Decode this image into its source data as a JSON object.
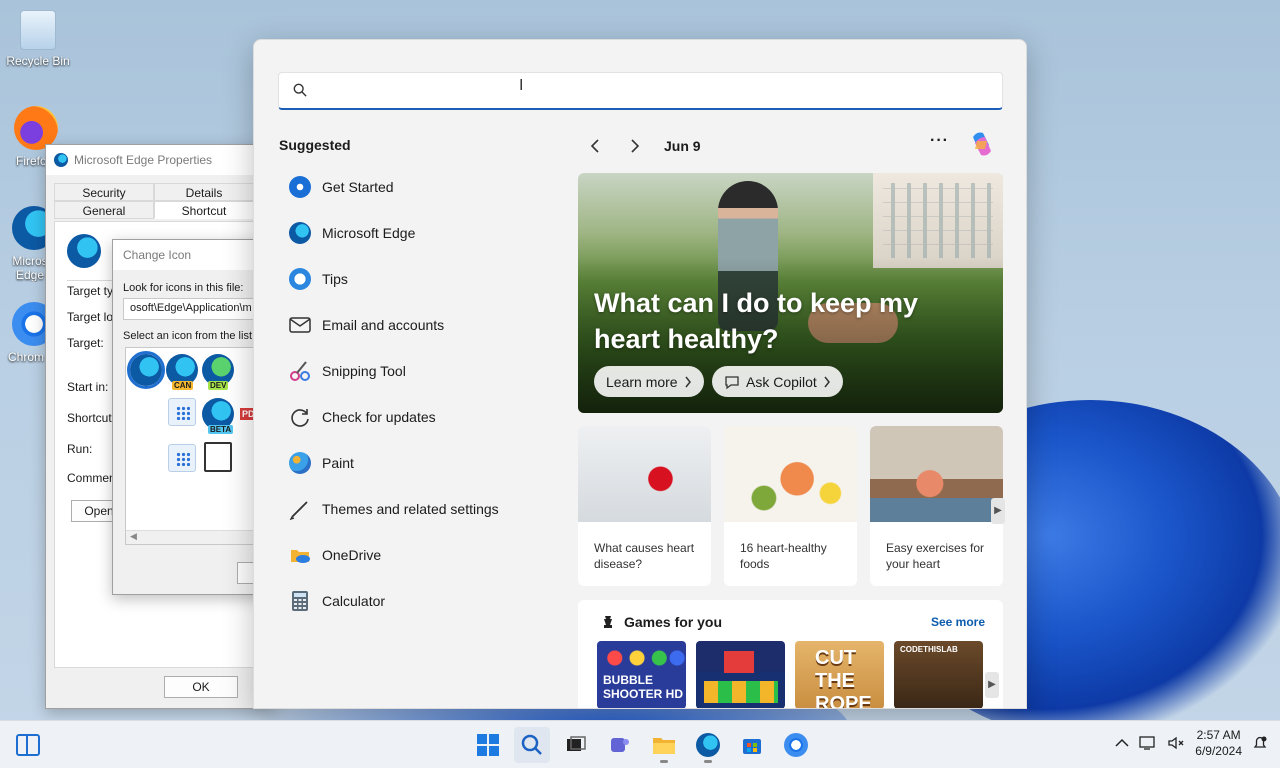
{
  "desktop": {
    "icons": [
      {
        "label": "Recycle Bin",
        "icon": "recycle-bin-icon"
      },
      {
        "label": "Firefo",
        "icon": "firefox-icon"
      },
      {
        "label": "Micros Edge",
        "icon": "edge-icon"
      },
      {
        "label": "Chrom",
        "icon": "chrome-icon"
      }
    ]
  },
  "properties_dialog": {
    "title": "Microsoft Edge Properties",
    "tabs_row1": [
      "Security",
      "Details"
    ],
    "tabs_row2": [
      "General",
      "Shortcut"
    ],
    "fields": [
      "Target typ",
      "Target loc",
      "Target:",
      "Start in:",
      "Shortcut k",
      "Run:",
      "Comment:"
    ],
    "open_button": "Open",
    "ok_button": "OK"
  },
  "change_icon_dialog": {
    "title": "Change Icon",
    "look_label": "Look for icons in this file:",
    "path_value": "osoft\\Edge\\Application\\m",
    "select_label": "Select an icon from the list",
    "badges": {
      "can": "CAN",
      "dev": "DEV",
      "beta": "BETA",
      "pdf": "PD"
    }
  },
  "start_menu": {
    "search_placeholder": "",
    "suggested_title": "Suggested",
    "suggested": [
      {
        "label": "Get Started",
        "icon": "get-started-icon",
        "color": "#1a6fd6"
      },
      {
        "label": "Microsoft Edge",
        "icon": "edge-icon",
        "color": "#0c59a4"
      },
      {
        "label": "Tips",
        "icon": "tips-icon",
        "color": "#2b86e0"
      },
      {
        "label": "Email and accounts",
        "icon": "mail-icon",
        "color": "#333333"
      },
      {
        "label": "Snipping Tool",
        "icon": "snipping-tool-icon",
        "color": "#d13b8a"
      },
      {
        "label": "Check for updates",
        "icon": "update-icon",
        "color": "#333333"
      },
      {
        "label": "Paint",
        "icon": "paint-icon",
        "color": "#3aa0e8"
      },
      {
        "label": "Themes and related settings",
        "icon": "pen-icon",
        "color": "#333333"
      },
      {
        "label": "OneDrive",
        "icon": "onedrive-icon",
        "color": "#f2b233"
      },
      {
        "label": "Calculator",
        "icon": "calculator-icon",
        "color": "#5c6b7a"
      }
    ],
    "date": "Jun 9",
    "more_label": "···",
    "hero": {
      "headline": "What can I do to keep my heart healthy?",
      "learn_more": "Learn more",
      "ask_copilot": "Ask Copilot"
    },
    "cards": [
      {
        "caption": "What causes heart disease?"
      },
      {
        "caption": "16 heart-healthy foods"
      },
      {
        "caption": "Easy exercises for your heart"
      }
    ],
    "games": {
      "title": "Games for you",
      "see_more": "See more",
      "tiles": [
        "BUBBLE SHOOTER HD",
        "",
        "CUT THE ROPE",
        "CODETHISLAB"
      ]
    }
  },
  "taskbar": {
    "time": "2:57 AM",
    "date": "6/9/2024",
    "apps": [
      "start-icon",
      "search-icon",
      "task-view-icon",
      "teams-icon",
      "file-explorer-icon",
      "edge-icon",
      "store-icon",
      "chrome-icon"
    ]
  }
}
